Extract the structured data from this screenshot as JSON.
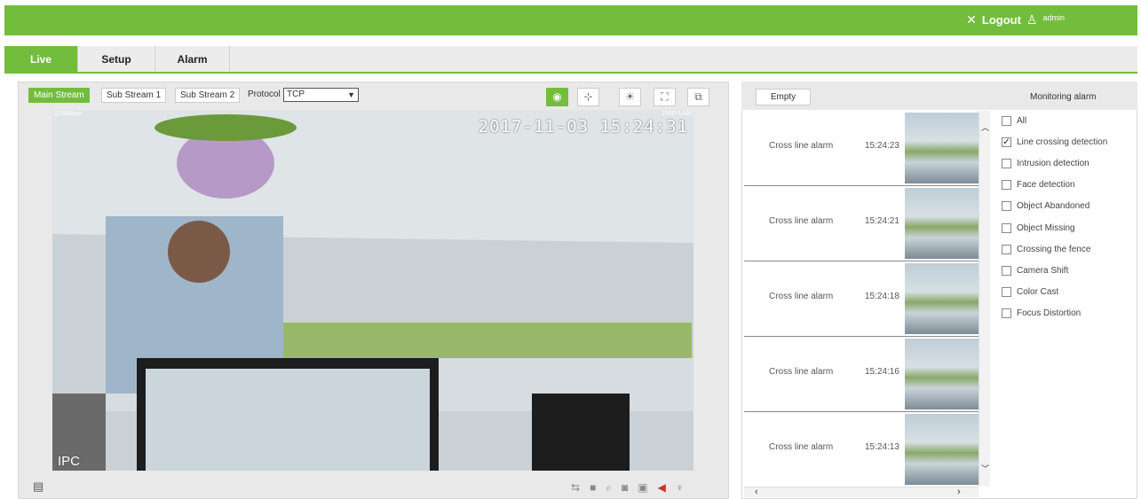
{
  "header": {
    "logout_label": "Logout",
    "username": "admin",
    "brand_color": "#73bd3d"
  },
  "tabs": [
    {
      "label": "Live"
    },
    {
      "label": "Setup"
    },
    {
      "label": "Alarm"
    }
  ],
  "stream": {
    "buttons": [
      "Main Stream",
      "Sub Stream 1",
      "Sub Stream 2"
    ],
    "protocol_label": "Protocol",
    "protocol_value": "TCP"
  },
  "video": {
    "timestamp": "2017-11-03 15:24:31",
    "watermark": "IPC",
    "bitrate": "2258Kbps",
    "resolution": "2560*1440"
  },
  "alarm_panel": {
    "empty_label": "Empty",
    "title": "Monitoring alarm",
    "alarms": [
      {
        "name": "Cross line alarm",
        "time": "15:24:23"
      },
      {
        "name": "Cross line alarm",
        "time": "15:24:21"
      },
      {
        "name": "Cross line alarm",
        "time": "15:24:18"
      },
      {
        "name": "Cross line alarm",
        "time": "15:24:16"
      },
      {
        "name": "Cross line alarm",
        "time": "15:24:13"
      }
    ],
    "filters": [
      {
        "label": "All",
        "checked": false
      },
      {
        "label": "Line crossing detection",
        "checked": true
      },
      {
        "label": "Intrusion detection",
        "checked": false
      },
      {
        "label": "Face detection",
        "checked": false
      },
      {
        "label": "Object Abandoned",
        "checked": false
      },
      {
        "label": "Object Missing",
        "checked": false
      },
      {
        "label": "Crossing the fence",
        "checked": false
      },
      {
        "label": "Camera Shift",
        "checked": false
      },
      {
        "label": "Color Cast",
        "checked": false
      },
      {
        "label": "Focus Distortion",
        "checked": false
      }
    ]
  }
}
